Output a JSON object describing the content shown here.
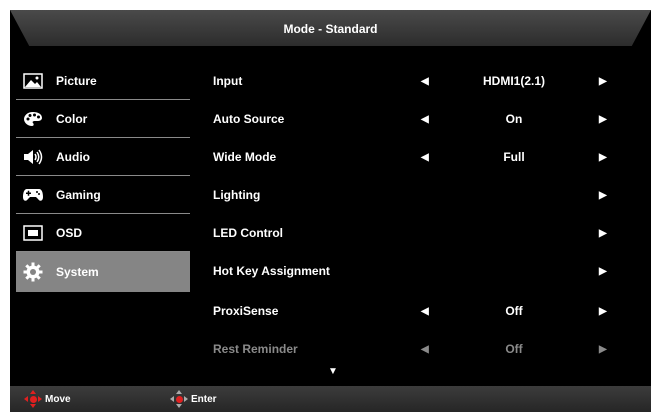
{
  "title": "Mode - Standard",
  "sidebar": {
    "items": [
      {
        "label": "Picture",
        "icon": "picture-icon"
      },
      {
        "label": "Color",
        "icon": "palette-icon"
      },
      {
        "label": "Audio",
        "icon": "speaker-icon"
      },
      {
        "label": "Gaming",
        "icon": "gamepad-icon"
      },
      {
        "label": "OSD",
        "icon": "osd-icon"
      },
      {
        "label": "System",
        "icon": "gear-icon",
        "selected": true
      }
    ]
  },
  "menu": {
    "items": [
      {
        "label": "Input",
        "value": "HDMI1(2.1)"
      },
      {
        "label": "Auto Source",
        "value": "On"
      },
      {
        "label": "Wide Mode",
        "value": "Full"
      },
      {
        "label": "Lighting",
        "value": ""
      },
      {
        "label": "LED Control",
        "value": ""
      },
      {
        "label": "Hot Key Assignment",
        "value": ""
      },
      {
        "label": "ProxiSense",
        "value": "Off"
      },
      {
        "label": "Rest Reminder",
        "value": "Off",
        "disabled": true
      }
    ],
    "left_arrow": "◀",
    "right_arrow": "▶",
    "more_indicator": "▼"
  },
  "help": {
    "move_label": "Move",
    "enter_label": "Enter"
  },
  "colors": {
    "background": "#000000",
    "selected": "#858585",
    "accent": "#e02020",
    "disabled_text": "#8a8a8a"
  }
}
